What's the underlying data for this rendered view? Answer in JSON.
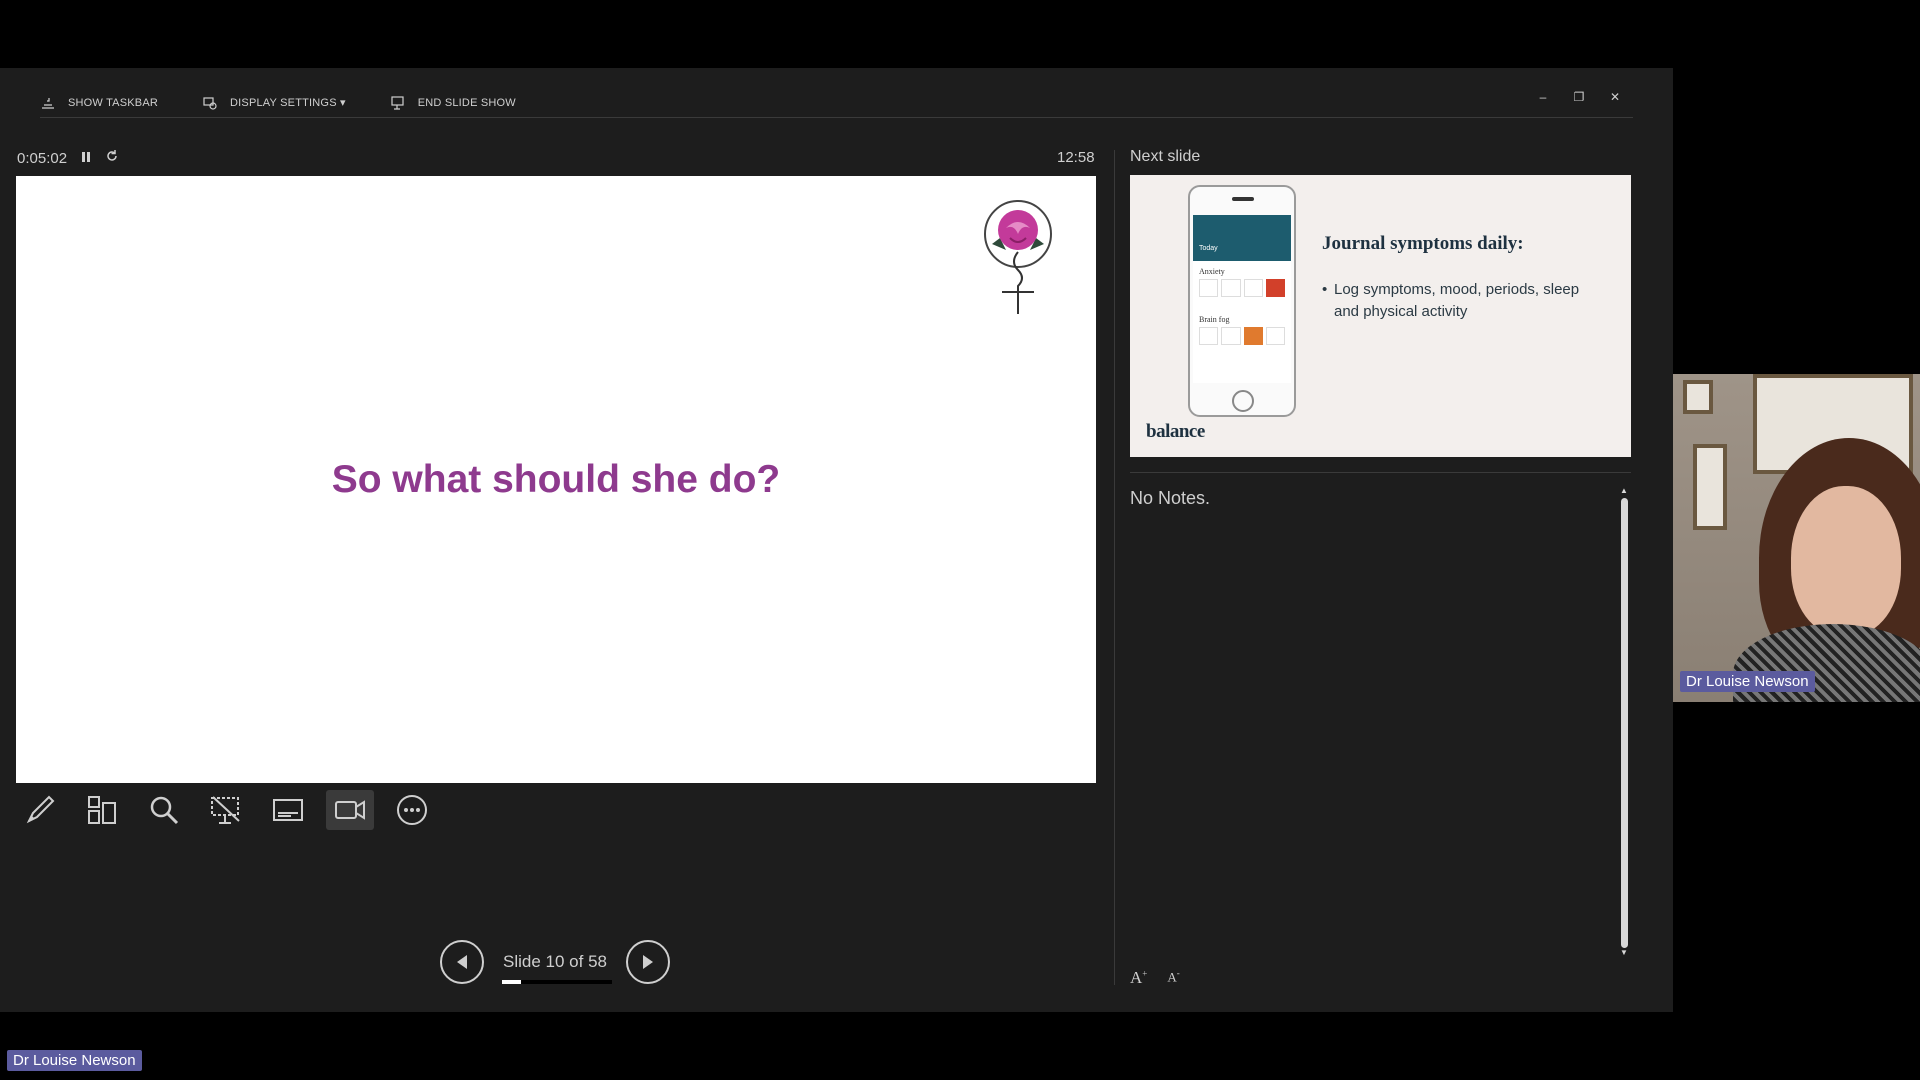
{
  "toolbar": {
    "show_taskbar": "SHOW TASKBAR",
    "display_settings": "DISPLAY SETTINGS",
    "display_settings_arrow": "▾",
    "end_slide_show": "END SLIDE SHOW"
  },
  "window": {
    "minimize": "–",
    "restore": "❐",
    "close": "✕"
  },
  "timer": {
    "elapsed": "0:05:02",
    "clock": "12:58"
  },
  "current_slide": {
    "title": "So what should she do?"
  },
  "tools": [
    "pen-icon",
    "grid-icon",
    "magnifier-icon",
    "presentation-icon",
    "subtitles-icon",
    "camera-icon",
    "more-icon"
  ],
  "navigation": {
    "label": "Slide 10 of 58",
    "progress": 0.172
  },
  "next_slide": {
    "label": "Next slide",
    "title": "Journal symptoms daily:",
    "bullets": [
      "Log symptoms, mood, periods, sleep and physical activity"
    ],
    "brand": "balance",
    "phone": {
      "header": "Today",
      "section1": "Anxiety",
      "section2": "Brain fog"
    }
  },
  "notes": {
    "text": "No Notes."
  },
  "font_controls": {
    "increase": "A",
    "decrease": "A"
  },
  "participant": {
    "camera_name": "Dr Louise Newson",
    "bottom_name": "Dr Louise Newson"
  },
  "colors": {
    "title": "#8e3a8e",
    "panel": "#1d1d1d",
    "name_tag": "#5b5b9e",
    "phone_header": "#1d5c6e"
  }
}
